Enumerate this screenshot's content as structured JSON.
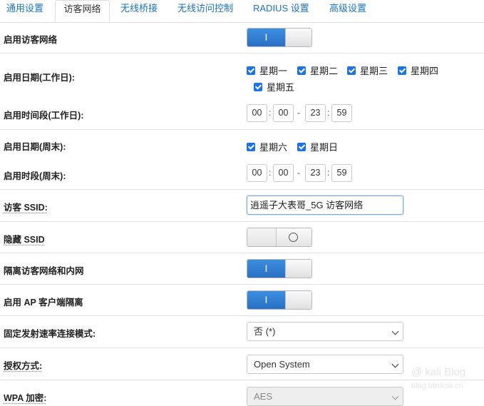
{
  "tabs": [
    {
      "label": "通用设置"
    },
    {
      "label": "访客网络"
    },
    {
      "label": "无线桥接"
    },
    {
      "label": "无线访问控制"
    },
    {
      "label": "RADIUS 设置"
    },
    {
      "label": "高级设置"
    }
  ],
  "active_tab": 1,
  "rows": {
    "enable_guest": {
      "label": "启用访客网络",
      "toggle": "on",
      "on_label": "I"
    },
    "weekday_days": {
      "label": "启用日期(工作日):",
      "days": [
        "星期一",
        "星期二",
        "星期三",
        "星期四",
        "星期五"
      ]
    },
    "weekday_time": {
      "label": "启用时间段(工作日):",
      "start_h": "00",
      "start_m": "00",
      "end_h": "23",
      "end_m": "59",
      "colon": ":",
      "dash": "-"
    },
    "weekend_days": {
      "label": "启用日期(周末):",
      "days": [
        "星期六",
        "星期日"
      ]
    },
    "weekend_time": {
      "label": "启用时段(周末):",
      "start_h": "00",
      "start_m": "00",
      "end_h": "23",
      "end_m": "59",
      "colon": ":",
      "dash": "-"
    },
    "guest_ssid": {
      "label": "访客 SSID:",
      "value": "逍遥子大表哥_5G 访客网络"
    },
    "hide_ssid": {
      "label": "隐藏 SSID",
      "toggle": "off"
    },
    "isolate": {
      "label": "隔离访客网络和内网",
      "toggle": "on",
      "on_label": "I"
    },
    "ap_isolate": {
      "label": "启用 AP 客户端隔离",
      "toggle": "on",
      "on_label": "I"
    },
    "fixed_rate": {
      "label": "固定发射速率连接模式:",
      "value": "否 (*)"
    },
    "auth": {
      "label": "授权方式:",
      "value": "Open System"
    },
    "wpa": {
      "label": "WPA 加密:",
      "value": "AES"
    }
  },
  "watermark": {
    "line1": "@ kali Blog",
    "line2": "blog.bbskali.cn"
  },
  "colors": {
    "accent": "#2a70c4",
    "link": "#1a73c8",
    "checkbox": "#1a73e8"
  }
}
